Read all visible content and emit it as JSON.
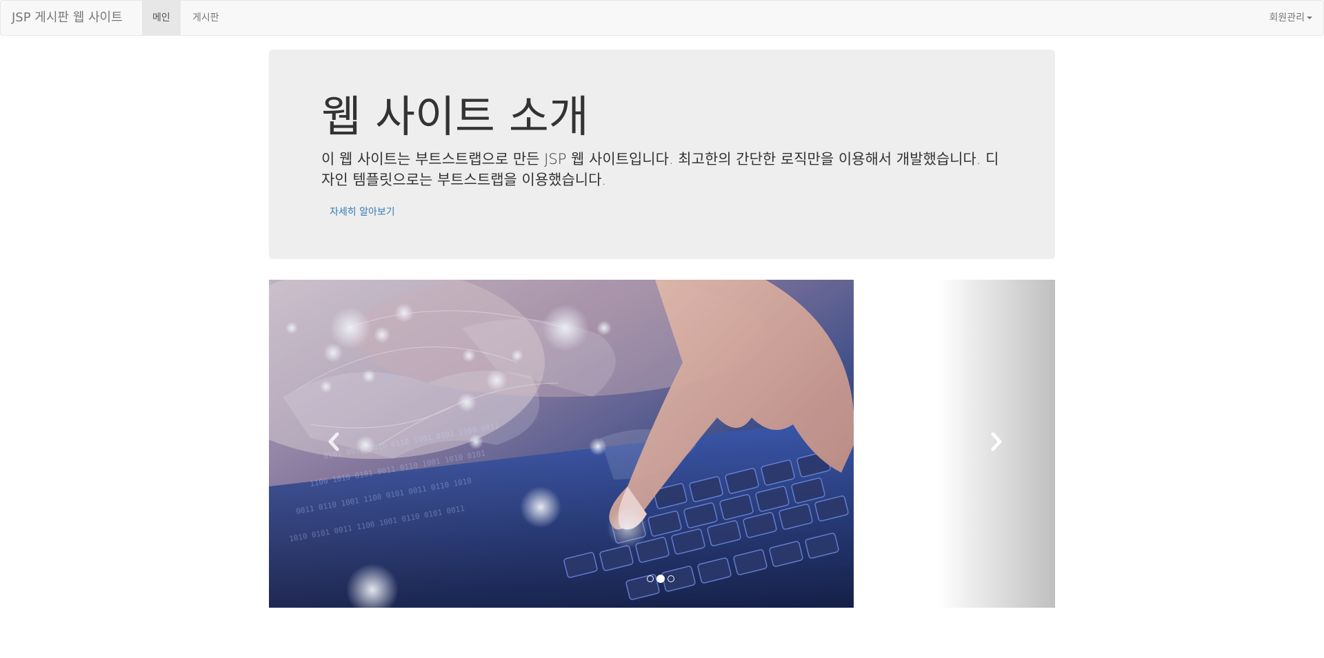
{
  "navbar": {
    "brand": "JSP 게시판 웹 사이트",
    "items": [
      {
        "label": "메인",
        "active": true
      },
      {
        "label": "게시판",
        "active": false
      }
    ],
    "right_menu": "회원관리"
  },
  "jumbotron": {
    "title": "웹 사이트 소개",
    "description": "이 웹 사이트는 부트스트랩으로 만든 JSP 웹 사이트입니다. 최고한의 간단한 로직만을 이용해서 개발했습니다. 디자인 템플릿으로는 부트스트랩을 이용했습니다.",
    "link": "자세히 알아보기"
  },
  "carousel": {
    "indicators": 3,
    "active_index": 1,
    "prev_icon": "chevron-left-icon",
    "next_icon": "chevron-right-icon"
  },
  "colors": {
    "navbar_bg": "#f8f8f8",
    "jumbotron_bg": "#eeeeee",
    "link": "#337ab7"
  }
}
